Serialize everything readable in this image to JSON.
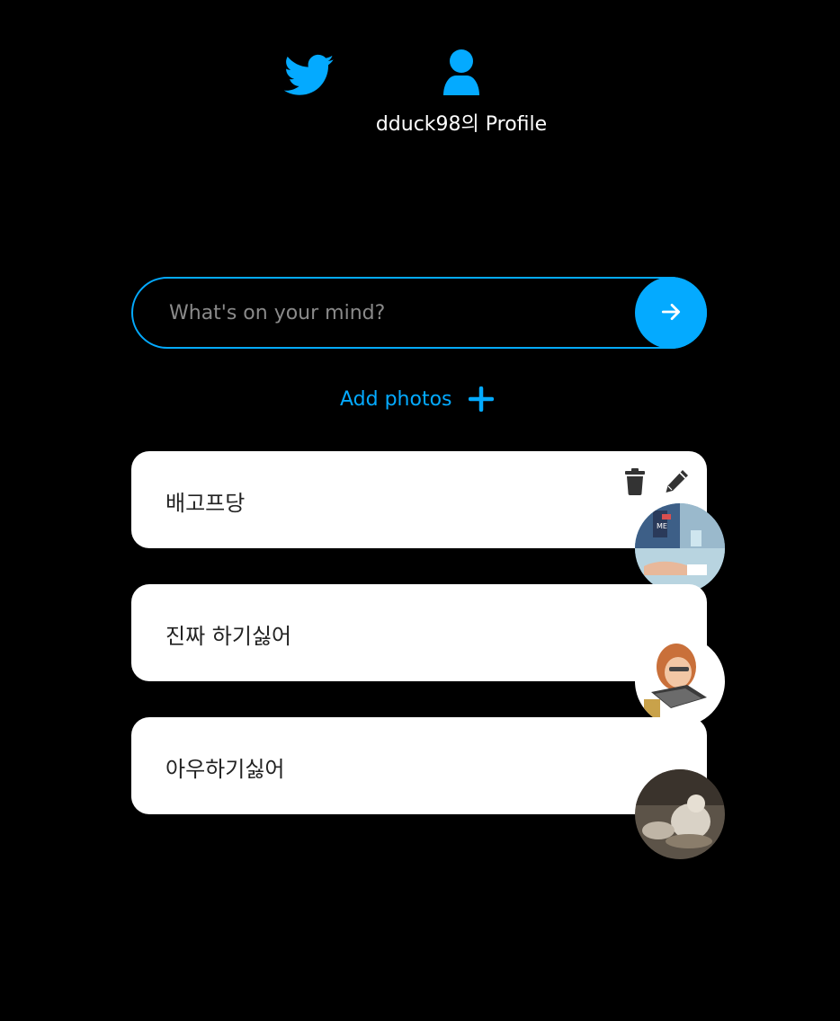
{
  "nav": {
    "home_icon": "twitter-bird-icon",
    "profile_icon": "user-icon",
    "profile_label": "dduck98의 Profile"
  },
  "composer": {
    "placeholder": "What's on your mind?",
    "value": "",
    "submit_icon": "arrow-right-icon"
  },
  "add_photos": {
    "label": "Add photos",
    "icon": "plus-icon"
  },
  "tweets": [
    {
      "text": "배고프당",
      "has_actions": true,
      "photo": "meme-thumbnail"
    },
    {
      "text": "진짜 하기싫어",
      "has_actions": false,
      "photo": "woman-biting-laptop-thumbnail"
    },
    {
      "text": "아우하기싫어",
      "has_actions": false,
      "photo": "cat-thumbnail"
    }
  ],
  "colors": {
    "accent": "#04aaff",
    "background": "#000000",
    "card": "#ffffff"
  }
}
